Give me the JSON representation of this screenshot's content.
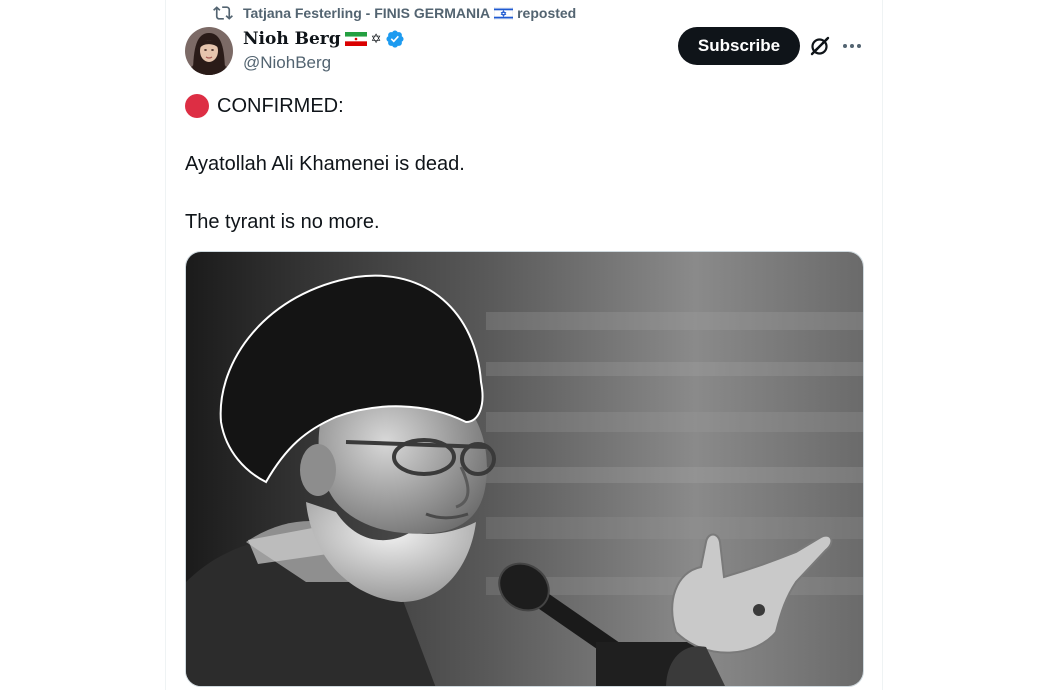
{
  "repost": {
    "reposter_name": "Tatjana Festerling - FINIS GERMANIA",
    "label": "reposted",
    "icon": "repost-icon"
  },
  "author": {
    "display_name": "Nioh Berg",
    "handle": "@NiohBerg",
    "badges": [
      "iran-flag-icon",
      "star-of-david-icon",
      "verified-badge-icon"
    ],
    "star_glyph": "✡"
  },
  "actions": {
    "subscribe_label": "Subscribe",
    "grok_icon": "grok-icon",
    "more_icon": "more-icon"
  },
  "tweet": {
    "line1": "CONFIRMED:",
    "line2": "Ayatollah Ali Khamenei is dead.",
    "line3": "The tyrant is no more."
  },
  "colors": {
    "subscribe_bg": "#0f1419",
    "verified_blue": "#1d9bf0",
    "secondary_text": "#536471",
    "red_circle": "#dd2e44"
  }
}
